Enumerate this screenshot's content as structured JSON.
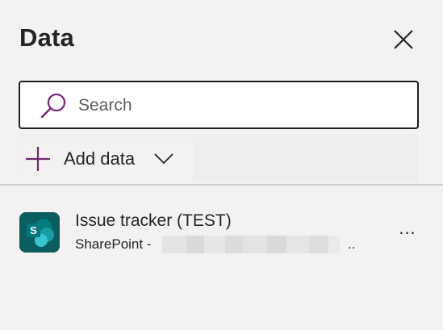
{
  "panel": {
    "title": "Data"
  },
  "search": {
    "placeholder": "Search",
    "value": ""
  },
  "add_data": {
    "label": "Add data"
  },
  "sources": [
    {
      "name": "Issue tracker (TEST)",
      "subtitle": "SharePoint - ",
      "subtitle_tail": "..",
      "icon": "sharepoint-icon",
      "more_label": "..."
    }
  ],
  "colors": {
    "accent": "#742774",
    "sharepoint_dark": "#036c70",
    "sharepoint_mid": "#1a9ba1",
    "sharepoint_light": "#37c6d0",
    "background": "#f3f2f1"
  }
}
